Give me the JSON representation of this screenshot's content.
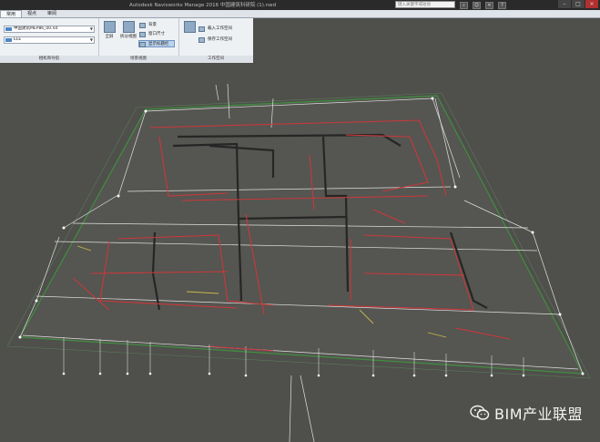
{
  "window": {
    "title": "Autodesk Navisworks Manage 2016 中国建筑科研院 (1).nwd",
    "search_placeholder": "键入关键字或短语",
    "toolbar_icons": [
      "binoculars-icon",
      "signin-icon",
      "exchange-icon",
      "help-icon"
    ]
  },
  "tabs": [
    "常用",
    "视点",
    "审阅"
  ],
  "ribbon": {
    "panel1": {
      "combo1": "中国建筑MEP86_00.nd",
      "combo2": "ELE",
      "label": "相机和导航"
    },
    "panel2": {
      "btn_fullscreen": "全屏",
      "btn_tile": "拆分视图",
      "small_btns": [
        "背景",
        "窗口尺寸",
        "显示标题栏"
      ],
      "label": "场景视图"
    },
    "panel3": {
      "small_btns": [
        "载入工作空间",
        "保存工作空间"
      ],
      "label": "工作空间"
    }
  },
  "watermark": {
    "text": "BIM产业联盟",
    "icon": "wechat-icon"
  },
  "colors": {
    "viewport_bg": "#4f4f4b",
    "pipe_red": "#c8393a",
    "pipe_dark": "#2a2a2a",
    "grid_white": "#e8e8e8",
    "floor_edge": "#3f8f3f"
  }
}
